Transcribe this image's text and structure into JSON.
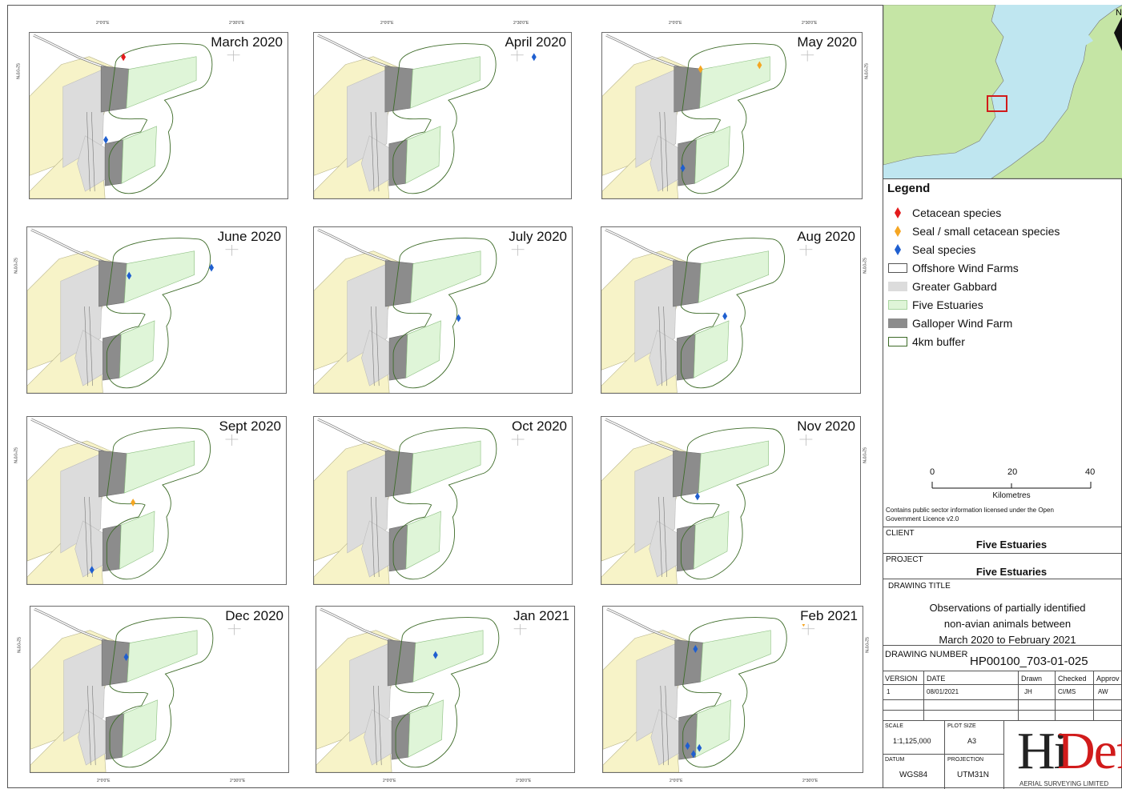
{
  "panels": [
    {
      "month": "March 2020",
      "points": [
        {
          "type": "cetacean",
          "x": 1.71,
          "y": 52.3
        },
        {
          "type": "seal",
          "x": 1.62,
          "y": 51.89
        }
      ]
    },
    {
      "month": "April 2020",
      "points": [
        {
          "type": "seal",
          "x": 2.36,
          "y": 52.3
        }
      ]
    },
    {
      "month": "May 2020",
      "points": [
        {
          "type": "seal_small_cetacean",
          "x": 1.73,
          "y": 52.24
        },
        {
          "type": "seal_small_cetacean",
          "x": 2.03,
          "y": 52.26
        },
        {
          "type": "seal",
          "x": 1.64,
          "y": 51.75
        }
      ]
    },
    {
      "month": "June 2020",
      "points": [
        {
          "type": "seal",
          "x": 1.75,
          "y": 52.18
        },
        {
          "type": "seal",
          "x": 2.17,
          "y": 52.22
        }
      ]
    },
    {
      "month": "July 2020",
      "points": [
        {
          "type": "seal",
          "x": 1.97,
          "y": 51.97
        }
      ]
    },
    {
      "month": "Aug 2020",
      "points": [
        {
          "type": "seal",
          "x": 1.86,
          "y": 51.98
        }
      ]
    },
    {
      "month": "Sept 2020",
      "points": [
        {
          "type": "seal_small_cetacean",
          "x": 1.77,
          "y": 52.0
        },
        {
          "type": "seal",
          "x": 1.56,
          "y": 51.67
        }
      ]
    },
    {
      "month": "Oct 2020",
      "points": []
    },
    {
      "month": "Nov 2020",
      "points": [
        {
          "type": "seal",
          "x": 1.72,
          "y": 52.03
        }
      ]
    },
    {
      "month": "Dec 2020",
      "points": [
        {
          "type": "seal",
          "x": 1.72,
          "y": 52.17
        }
      ]
    },
    {
      "month": "Jan 2021",
      "points": [
        {
          "type": "seal",
          "x": 1.84,
          "y": 52.18
        }
      ]
    },
    {
      "month": "Feb 2021",
      "points": [
        {
          "type": "seal_small_cetacean",
          "x": 2.25,
          "y": 52.34
        },
        {
          "type": "seal",
          "x": 1.7,
          "y": 52.21
        },
        {
          "type": "seal",
          "x": 1.66,
          "y": 51.73
        },
        {
          "type": "seal",
          "x": 1.69,
          "y": 51.69
        },
        {
          "type": "seal",
          "x": 1.72,
          "y": 51.72
        }
      ]
    }
  ],
  "axes": {
    "top_ticks": [
      "2°0'0\"E",
      "2°30'0\"E"
    ],
    "bottom_ticks": [
      "2°0'0\"E",
      "2°30'0\"E"
    ],
    "lat_tick": "52°0'0\"N"
  },
  "legend": {
    "title": "Legend",
    "items": [
      {
        "label": "Cetacean species",
        "kind": "diamond",
        "color": "#e31a1c"
      },
      {
        "label": "Seal / small cetacean species",
        "kind": "diamond",
        "color": "#f5a623"
      },
      {
        "label": "Seal species",
        "kind": "diamond",
        "color": "#1f5fd0"
      },
      {
        "label": "Offshore Wind Farms",
        "kind": "box",
        "fill": "#ffffff",
        "stroke": "#555555"
      },
      {
        "label": "Greater Gabbard",
        "kind": "box",
        "fill": "#dcdcdc",
        "stroke": "#dcdcdc"
      },
      {
        "label": "Five Estuaries",
        "kind": "box",
        "fill": "#dff5d8",
        "stroke": "#a9d5a0"
      },
      {
        "label": "Galloper Wind Farm",
        "kind": "box",
        "fill": "#8c8c8c",
        "stroke": "#8c8c8c"
      },
      {
        "label": "4km buffer",
        "kind": "box",
        "fill": "#ffffff",
        "stroke": "#3d6b28"
      }
    ]
  },
  "scale_bar": {
    "labels": [
      "0",
      "20",
      "40"
    ],
    "unit": "Kilometres"
  },
  "licence": "Contains public sector information licensed under the Open Government Licence v2.0",
  "title_block": {
    "client_label": "CLIENT",
    "client": "Five Estuaries",
    "project_label": "PROJECT",
    "project": "Five Estuaries",
    "drawing_title_label": "DRAWING TITLE",
    "drawing_title_lines": [
      "Observations of partially identified",
      "non-avian animals between",
      "March 2020 to February 2021"
    ],
    "drawing_number_label": "DRAWING NUMBER",
    "drawing_number": "HP00100_703-01-025",
    "table_headers": [
      "VERSION",
      "DATE",
      "Drawn",
      "Checked",
      "Approv"
    ],
    "table_row": [
      "1",
      "08/01/2021",
      "JH",
      "CI/MS",
      "AW"
    ],
    "scale_label": "SCALE",
    "scale": "1:1,125,000",
    "plot_size_label": "PLOT SIZE",
    "plot_size": "A3",
    "datum_label": "DATUM",
    "datum": "WGS84",
    "projection_label": "PROJECTION",
    "projection": "UTM31N",
    "logo_text": "HiDef",
    "logo_tagline": "AERIAL SURVEYING LIMITED"
  },
  "colors": {
    "cetacean": "#e31a1c",
    "seal_small_cetacean": "#f5a623",
    "seal": "#1f5fd0",
    "five_estuaries": "#dff5d8",
    "greater_gabbard": "#dcdcdc",
    "galloper": "#8c8c8c",
    "buffer": "#3d6b28",
    "land_coast": "#f7f3c8",
    "sea": "#bfe6f0",
    "inset_land": "#c5e5a5",
    "study_box": "#d11b1b"
  }
}
